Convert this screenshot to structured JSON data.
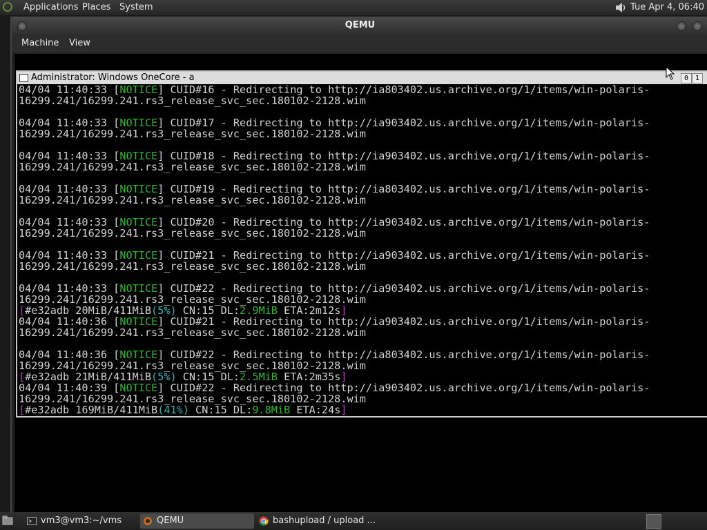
{
  "top_panel": {
    "menus": [
      "Applications",
      "Places",
      "System"
    ],
    "clock": "Tue Apr  4, 06:40"
  },
  "qemu": {
    "title": "QEMU",
    "menu": [
      "Machine",
      "View"
    ]
  },
  "console": {
    "title": "Administrator:  Windows OneCore - a",
    "buttons": [
      "0",
      "1"
    ],
    "lines": [
      {
        "type": "notice",
        "ts": "04/04 11:40:33",
        "cuid": "CUID#16",
        "host": "ia803402"
      },
      {
        "type": "cont",
        "text": "16299.241/16299.241.rs3_release_svc_sec.180102-2128.wim"
      },
      {
        "type": "blank"
      },
      {
        "type": "notice",
        "ts": "04/04 11:40:33",
        "cuid": "CUID#17",
        "host": "ia903402"
      },
      {
        "type": "cont",
        "text": "16299.241/16299.241.rs3_release_svc_sec.180102-2128.wim"
      },
      {
        "type": "blank"
      },
      {
        "type": "notice",
        "ts": "04/04 11:40:33",
        "cuid": "CUID#18",
        "host": "ia903402"
      },
      {
        "type": "cont",
        "text": "16299.241/16299.241.rs3_release_svc_sec.180102-2128.wim"
      },
      {
        "type": "blank"
      },
      {
        "type": "notice",
        "ts": "04/04 11:40:33",
        "cuid": "CUID#19",
        "host": "ia803402"
      },
      {
        "type": "cont",
        "text": "16299.241/16299.241.rs3_release_svc_sec.180102-2128.wim"
      },
      {
        "type": "blank"
      },
      {
        "type": "notice",
        "ts": "04/04 11:40:33",
        "cuid": "CUID#20",
        "host": "ia903402"
      },
      {
        "type": "cont",
        "text": "16299.241/16299.241.rs3_release_svc_sec.180102-2128.wim"
      },
      {
        "type": "blank"
      },
      {
        "type": "notice",
        "ts": "04/04 11:40:33",
        "cuid": "CUID#21",
        "host": "ia903402"
      },
      {
        "type": "cont",
        "text": "16299.241/16299.241.rs3_release_svc_sec.180102-2128.wim"
      },
      {
        "type": "blank"
      },
      {
        "type": "notice",
        "ts": "04/04 11:40:33",
        "cuid": "CUID#22",
        "host": "ia903402"
      },
      {
        "type": "cont",
        "text": "16299.241/16299.241.rs3_release_svc_sec.180102-2128.wim"
      },
      {
        "type": "progress",
        "id": "#e32adb",
        "size": "20MiB/411MiB",
        "pct": "(5%)",
        "cn": "CN:15",
        "dl": "2.9MiB",
        "eta": "ETA:2m12s"
      },
      {
        "type": "notice",
        "ts": "04/04 11:40:36",
        "cuid": "CUID#21",
        "host": "ia903402"
      },
      {
        "type": "cont",
        "text": "16299.241/16299.241.rs3_release_svc_sec.180102-2128.wim"
      },
      {
        "type": "blank"
      },
      {
        "type": "notice",
        "ts": "04/04 11:40:36",
        "cuid": "CUID#22",
        "host": "ia803402"
      },
      {
        "type": "cont",
        "text": "16299.241/16299.241.rs3_release_svc_sec.180102-2128.wim"
      },
      {
        "type": "progress",
        "id": "#e32adb",
        "size": "21MiB/411MiB",
        "pct": "(5%)",
        "cn": "CN:15",
        "dl": "2.5MiB",
        "eta": "ETA:2m35s"
      },
      {
        "type": "notice",
        "ts": "04/04 11:40:39",
        "cuid": "CUID#22",
        "host": "ia903402"
      },
      {
        "type": "cont",
        "text": "16299.241/16299.241.rs3_release_svc_sec.180102-2128.wim"
      },
      {
        "type": "progress",
        "id": "#e32adb",
        "size": "169MiB/411MiB",
        "pct": "(41%)",
        "cn": "CN:15",
        "dl": "9.8MiB",
        "eta": "ETA:24s"
      }
    ],
    "notice_word": "NOTICE",
    "redirect_prefix": " - Redirecting to http://",
    "redirect_suffix": ".us.archive.org/1/items/win-polaris-",
    "dl_prefix": "DL:"
  },
  "taskbar": {
    "tasks": [
      {
        "label": "vm3@vm3:~/vms",
        "icon": "terminal-icon",
        "active": false
      },
      {
        "label": "QEMU",
        "icon": "qemu-icon",
        "active": true
      },
      {
        "label": "bashupload / upload ...",
        "icon": "chrome-icon",
        "active": false
      }
    ]
  },
  "colors": {
    "notice": "#2fb52f",
    "progress_bracket": "#b23ab2",
    "percent": "#2fb5b5"
  }
}
